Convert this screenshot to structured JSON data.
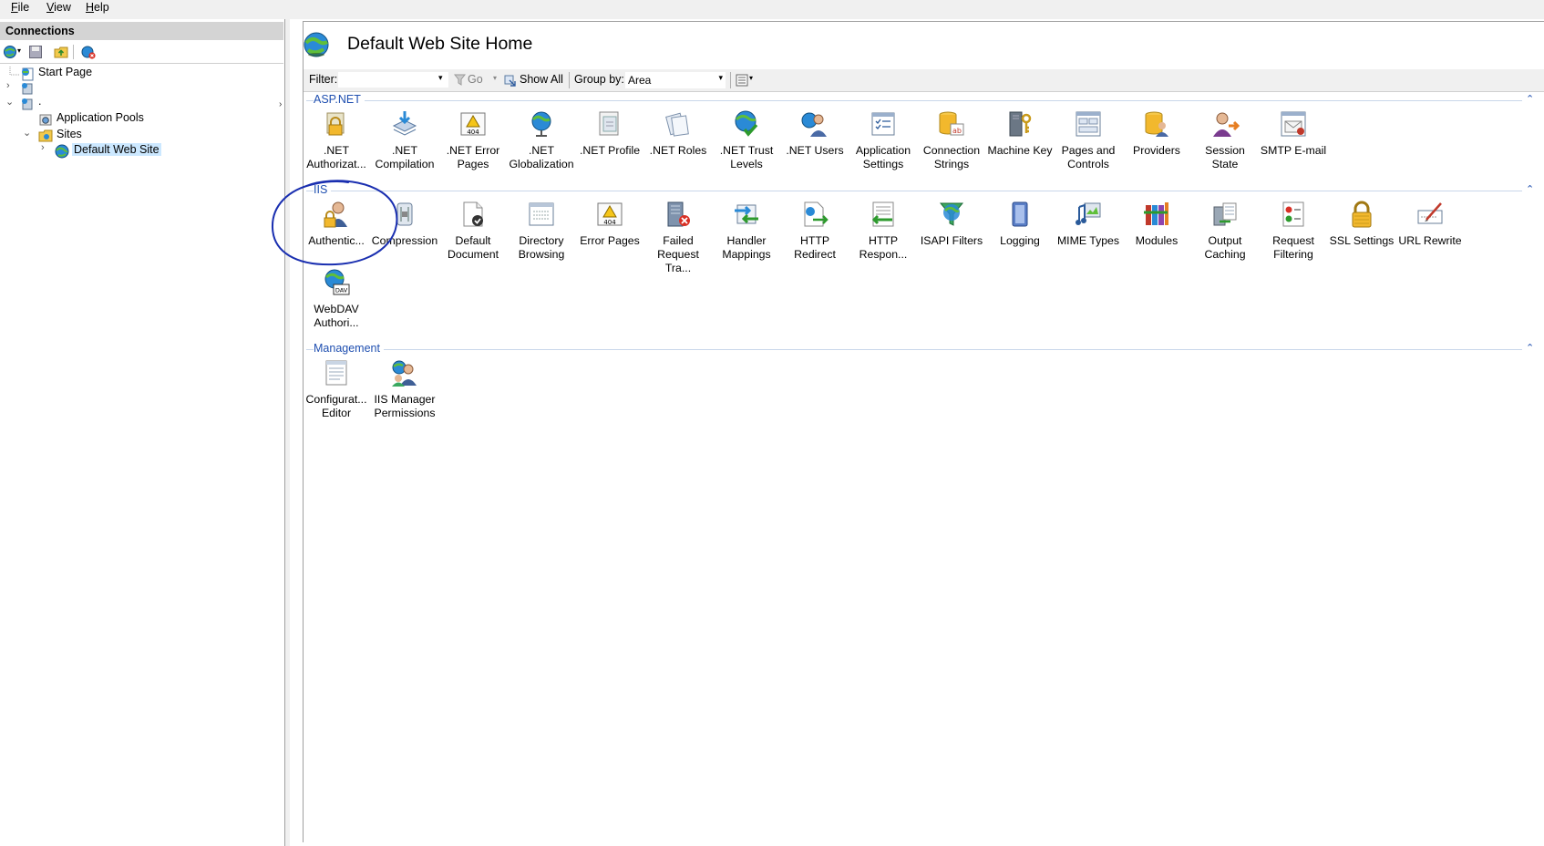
{
  "menu": [
    {
      "label": "File",
      "key": "F",
      "rest": "ile"
    },
    {
      "label": "View",
      "key": "V",
      "rest": "iew"
    },
    {
      "label": "Help",
      "key": "H",
      "rest": "elp"
    }
  ],
  "connections": {
    "header": "Connections",
    "tree": {
      "start_page": "Start Page",
      "server": ".",
      "app_pools": "Application Pools",
      "sites": "Sites",
      "default_site": "Default Web Site"
    }
  },
  "main": {
    "title": "Default Web Site Home",
    "filter": {
      "label": "Filter:",
      "value": "",
      "go": "Go",
      "show_all": "Show All",
      "group_by_label": "Group by:",
      "group_by_value": "Area"
    },
    "groups": {
      "aspnet": {
        "title": "ASP.NET",
        "items": [
          {
            "label": ".NET\nAuthorizat..."
          },
          {
            "label": ".NET\nCompilation"
          },
          {
            "label": ".NET Error\nPages"
          },
          {
            "label": ".NET\nGlobalization"
          },
          {
            "label": ".NET Profile"
          },
          {
            "label": ".NET Roles"
          },
          {
            "label": ".NET Trust\nLevels"
          },
          {
            "label": ".NET Users"
          },
          {
            "label": "Application\nSettings"
          },
          {
            "label": "Connection\nStrings"
          },
          {
            "label": "Machine Key"
          },
          {
            "label": "Pages and\nControls"
          },
          {
            "label": "Providers"
          },
          {
            "label": "Session State"
          },
          {
            "label": "SMTP E-mail"
          }
        ]
      },
      "iis": {
        "title": "IIS",
        "items": [
          {
            "label": "Authentic..."
          },
          {
            "label": "Compression"
          },
          {
            "label": "Default\nDocument"
          },
          {
            "label": "Directory\nBrowsing"
          },
          {
            "label": "Error Pages"
          },
          {
            "label": "Failed\nRequest Tra..."
          },
          {
            "label": "Handler\nMappings"
          },
          {
            "label": "HTTP\nRedirect"
          },
          {
            "label": "HTTP\nRespon..."
          },
          {
            "label": "ISAPI Filters"
          },
          {
            "label": "Logging"
          },
          {
            "label": "MIME Types"
          },
          {
            "label": "Modules"
          },
          {
            "label": "Output\nCaching"
          },
          {
            "label": "Request\nFiltering"
          },
          {
            "label": "SSL Settings"
          },
          {
            "label": "URL Rewrite"
          },
          {
            "label": "WebDAV\nAuthori..."
          }
        ]
      },
      "management": {
        "title": "Management",
        "items": [
          {
            "label": "Configurat...\nEditor"
          },
          {
            "label": "IIS Manager\nPermissions"
          }
        ]
      }
    }
  },
  "colors": {
    "group_heading": "#1f4fb0",
    "annotation_circle": "#1a2fb0",
    "selection": "#cce8ff"
  }
}
